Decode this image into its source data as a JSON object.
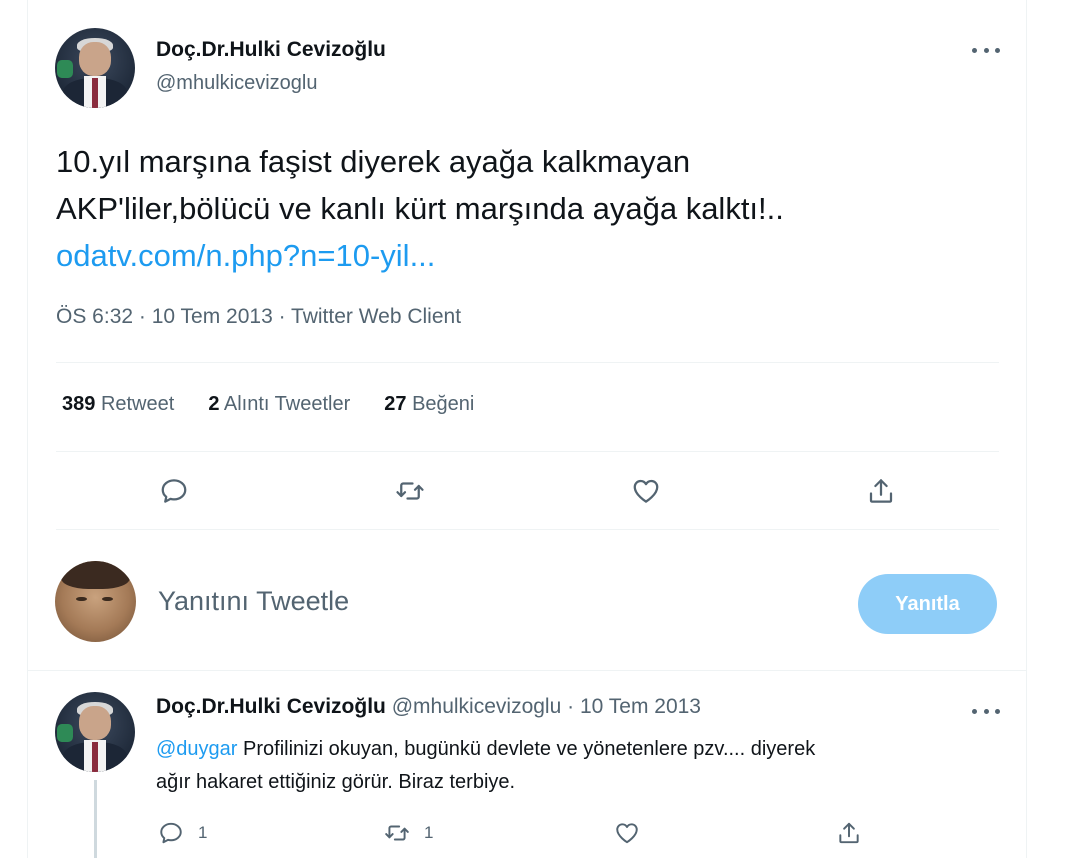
{
  "main_tweet": {
    "author_name": "Doç.Dr.Hulki Cevizoğlu",
    "author_handle": "@mhulkicevizoglu",
    "text_line1": "10.yıl marşına faşist diyerek ayağa kalkmayan",
    "text_line2": "AKP'liler,bölücü ve kanlı kürt marşında ayağa kalktı!..",
    "link": "odatv.com/n.php?n=10-yil...",
    "meta": "ÖS 6:32 · 10 Tem 2013 · Twitter Web Client",
    "stats": {
      "retweets_count": "389",
      "retweets_label": "Retweet",
      "quotes_count": "2",
      "quotes_label": "Alıntı Tweetler",
      "likes_count": "27",
      "likes_label": "Beğeni"
    },
    "icons": [
      "reply-icon",
      "retweet-icon",
      "like-icon",
      "share-icon",
      "more-icon"
    ]
  },
  "reply_composer": {
    "placeholder": "Yanıtını Tweetle",
    "button_label": "Yanıtla"
  },
  "reply_tweet": {
    "author_name": "Doç.Dr.Hulki Cevizoğlu",
    "author_handle": "@mhulkicevizoglu",
    "date": "· 10 Tem 2013",
    "mention": "@duygar",
    "text_line1": " Profilinizi okuyan, bugünkü devlete ve yönetenlere pzv.... diyerek",
    "text_line2": "ağır hakaret ettiğiniz görür. Biraz terbiye.",
    "reply_count": "1",
    "retweet_count": "1"
  },
  "colors": {
    "link": "#1d9bf0",
    "secondary_text": "#536471",
    "button_disabled": "#8ecdf8",
    "divider": "#eff3f4"
  }
}
